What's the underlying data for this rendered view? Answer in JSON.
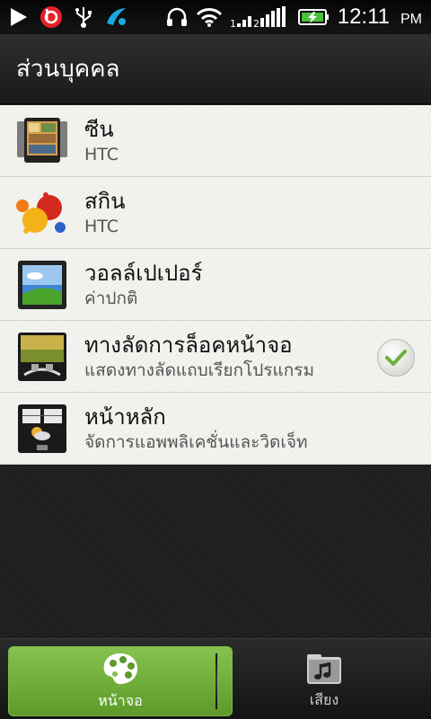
{
  "status_bar": {
    "time": "12:11",
    "ampm": "PM",
    "icons": [
      "play-icon",
      "beats-icon",
      "usb-icon",
      "telenor-icon",
      "headphones-icon",
      "wifi-icon",
      "signal-icon",
      "battery-charging-icon"
    ]
  },
  "header": {
    "title": "ส่วนบุคคล"
  },
  "list": {
    "items": [
      {
        "title": "ซีน",
        "subtitle": "HTC",
        "icon": "scene-icon"
      },
      {
        "title": "สกิน",
        "subtitle": "HTC",
        "icon": "skin-icon"
      },
      {
        "title": "วอลล์เปเปอร์",
        "subtitle": "ค่าปกติ",
        "icon": "wallpaper-icon"
      },
      {
        "title": "ทางลัดการล็อคหน้าจอ",
        "subtitle": "แสดงทางลัดแถบเรียกโปรแกรม",
        "icon": "lockscreen-icon",
        "checked": true
      },
      {
        "title": "หน้าหลัก",
        "subtitle": "จัดการแอพพลิเคชั่นและวิดเจ็ท",
        "icon": "home-widget-icon"
      }
    ]
  },
  "tabs": [
    {
      "label": "หน้าจอ",
      "icon": "palette-icon",
      "active": true
    },
    {
      "label": "เสียง",
      "icon": "music-folder-icon",
      "active": false
    }
  ],
  "colors": {
    "accent": "#6fae3b",
    "status_bg": "#0a0a0a",
    "list_bg": "#f1f1ee"
  }
}
